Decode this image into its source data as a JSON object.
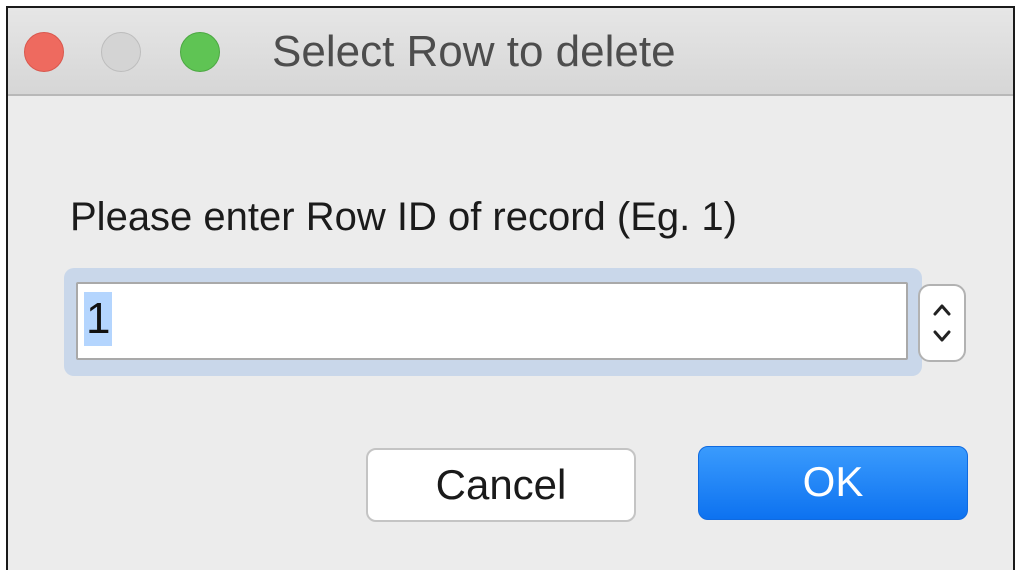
{
  "window": {
    "title": "Select Row to delete"
  },
  "dialog": {
    "prompt": "Please enter Row ID of record (Eg. 1)",
    "input_value": "1",
    "cancel_label": "Cancel",
    "ok_label": "OK"
  },
  "colors": {
    "close": "#ee6a5f",
    "minimize": "#d4d4d4",
    "zoom": "#5fc454",
    "ok_button": "#1a7ff5",
    "focus_ring": "#c9d7ea",
    "selection": "#b4d5fe"
  },
  "icons": {
    "stepper_up": "chevron-up-icon",
    "stepper_down": "chevron-down-icon"
  }
}
